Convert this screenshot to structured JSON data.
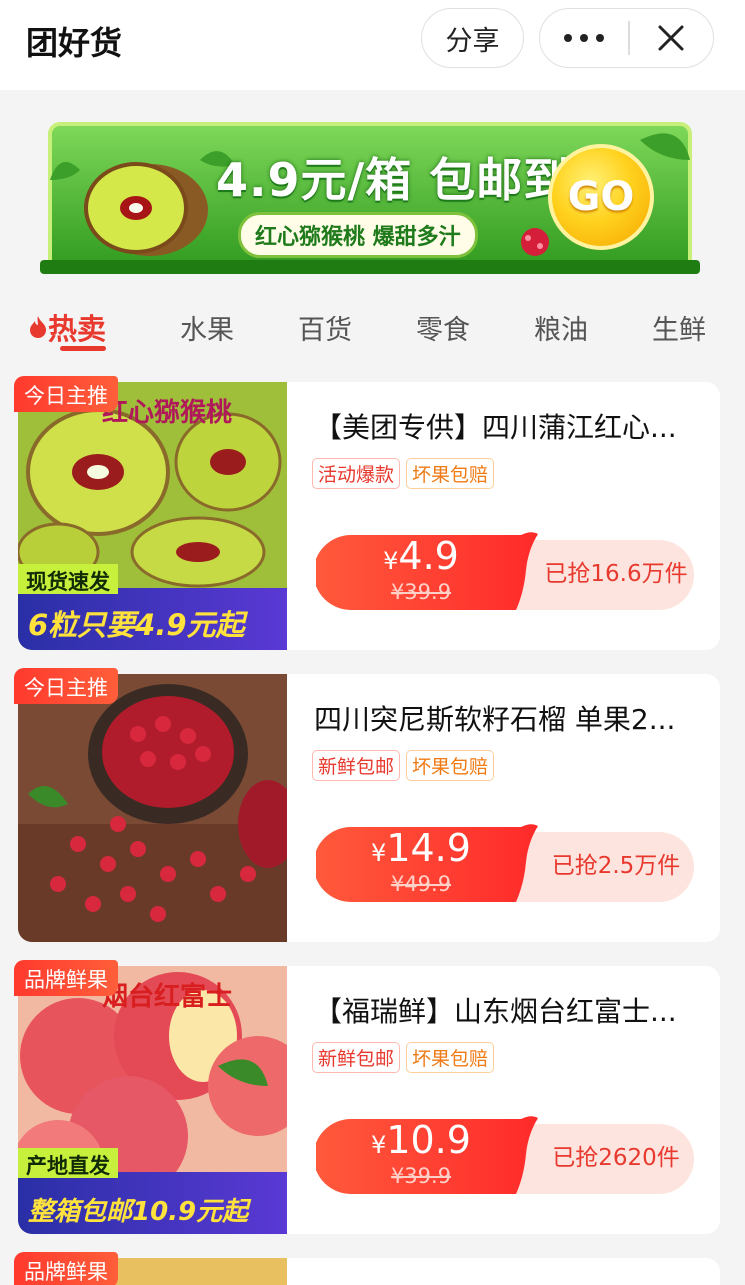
{
  "header": {
    "title": "团好货",
    "share_label": "分享",
    "more_icon": "more-dots-icon",
    "close_icon": "close-icon"
  },
  "banner": {
    "headline": "4.9元/箱 包邮到家",
    "subline": "红心猕猴桃 爆甜多汁",
    "go_label": "GO"
  },
  "tabs": [
    {
      "label": "热卖",
      "active": true,
      "icon": "flame-icon"
    },
    {
      "label": "水果"
    },
    {
      "label": "百货"
    },
    {
      "label": "零食"
    },
    {
      "label": "粮油"
    },
    {
      "label": "生鲜"
    }
  ],
  "products": [
    {
      "badge": "今日主推",
      "title": "【美团专供】四川蒲江红心...",
      "tags": [
        "活动爆款",
        "坏果包赔"
      ],
      "price_now": "4.9",
      "price_old": "¥39.9",
      "sold": "已抢16.6万件",
      "image_caption": "红心猕猴桃",
      "promo_label": "现货速发",
      "promo_text": "6粒只要4.9元起"
    },
    {
      "badge": "今日主推",
      "title": "四川突尼斯软籽石榴 单果2...",
      "tags": [
        "新鲜包邮",
        "坏果包赔"
      ],
      "price_now": "14.9",
      "price_old": "¥49.9",
      "sold": "已抢2.5万件"
    },
    {
      "badge": "品牌鲜果",
      "title": "【福瑞鲜】山东烟台红富士...",
      "tags": [
        "新鲜包邮",
        "坏果包赔"
      ],
      "price_now": "10.9",
      "price_old": "¥39.9",
      "sold": "已抢2620件",
      "image_caption": "烟台红富士",
      "promo_label": "产地直发",
      "promo_text": "整箱包邮10.9元起"
    },
    {
      "badge": "品牌鲜果"
    }
  ],
  "currency_symbol": "¥",
  "colors": {
    "accent": "#e8392e",
    "banner_green": "#3aa323",
    "go_yellow": "#ffd21e"
  }
}
